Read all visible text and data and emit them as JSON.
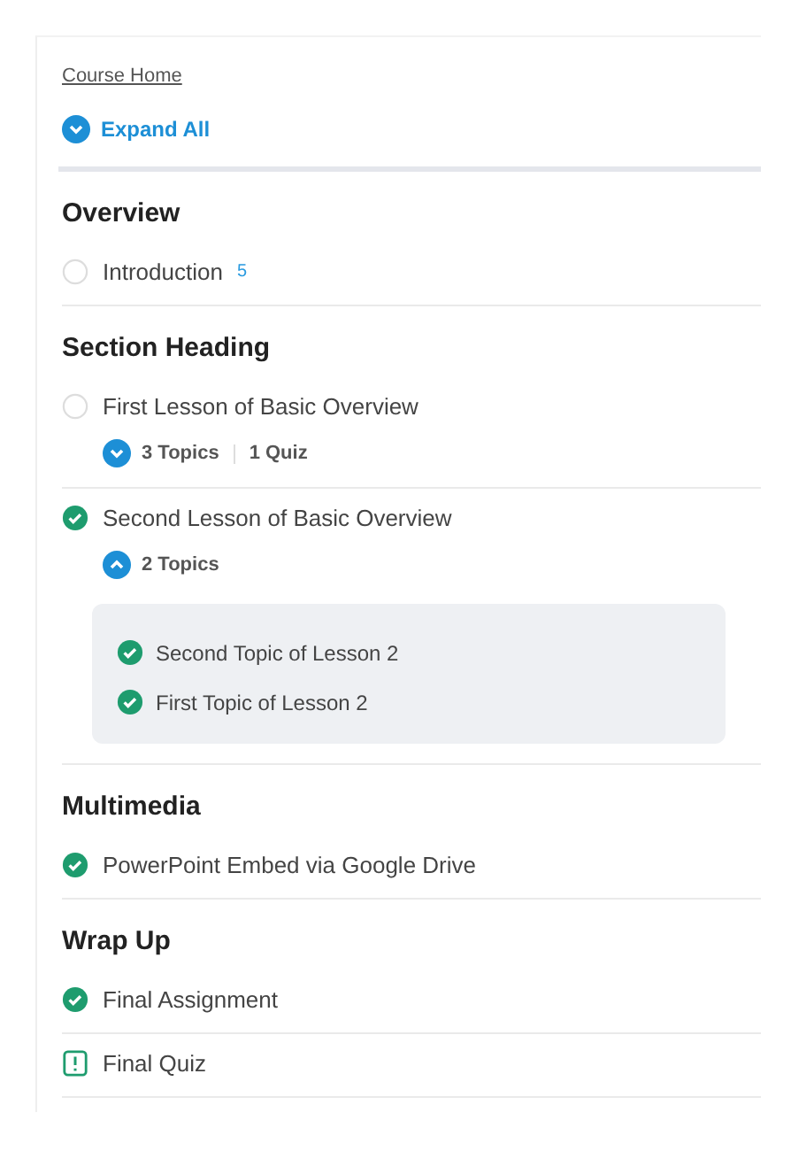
{
  "breadcrumb": "Course Home",
  "expand_all": {
    "label": "Expand All",
    "expanded": false
  },
  "sections": [
    {
      "heading": "Overview",
      "items": [
        {
          "kind": "lesson",
          "title": "Introduction",
          "completed": false,
          "badge": "5"
        }
      ]
    },
    {
      "heading": "Section Heading",
      "items": [
        {
          "kind": "lesson",
          "title": "First Lesson of Basic Overview",
          "completed": false,
          "topics": {
            "expanded": false,
            "count": "3 Topics",
            "quiz": "1 Quiz"
          }
        },
        {
          "kind": "lesson",
          "title": "Second Lesson of Basic Overview",
          "completed": true,
          "topics": {
            "expanded": true,
            "count": "2 Topics",
            "items": [
              {
                "title": "Second Topic of Lesson 2",
                "completed": true
              },
              {
                "title": "First Topic of Lesson 2",
                "completed": true
              }
            ]
          }
        }
      ]
    },
    {
      "heading": "Multimedia",
      "items": [
        {
          "kind": "lesson",
          "title": "PowerPoint Embed via Google Drive",
          "completed": true
        }
      ]
    },
    {
      "heading": "Wrap Up",
      "items": [
        {
          "kind": "lesson",
          "title": "Final Assignment",
          "completed": true
        },
        {
          "kind": "quiz",
          "title": "Final Quiz",
          "completed": false
        }
      ]
    }
  ]
}
